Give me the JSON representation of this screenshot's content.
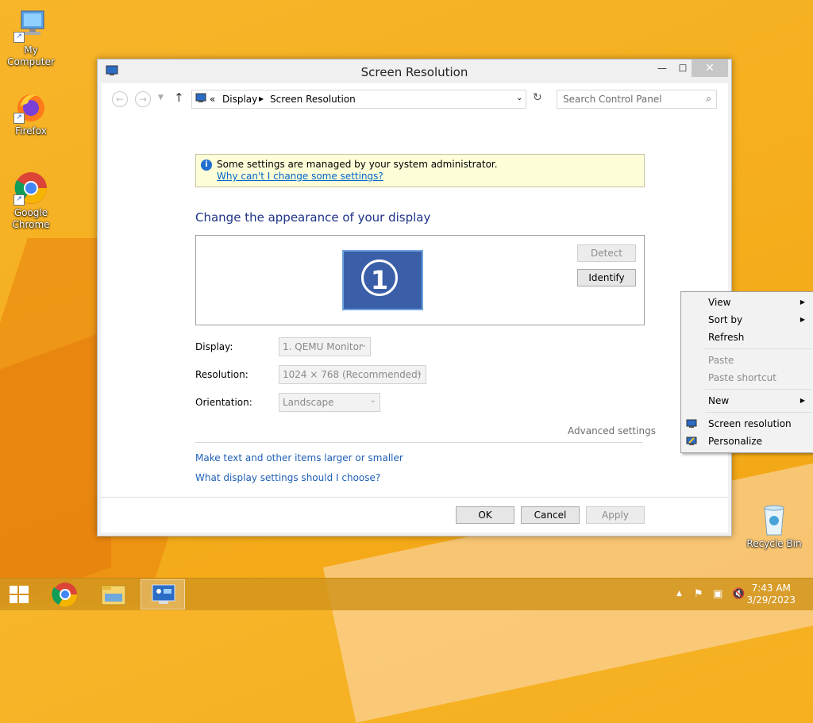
{
  "desktop": {
    "icons": [
      {
        "label": "My Computer"
      },
      {
        "label": "Firefox"
      },
      {
        "label": "Google Chrome"
      },
      {
        "label": "Recycle Bin"
      }
    ]
  },
  "window": {
    "title": "Screen Resolution",
    "controls": {
      "minimize": "—",
      "maximize": "☐",
      "close": "✕"
    },
    "address": {
      "prefix": "«",
      "crumbs": [
        "Display",
        "Screen Resolution"
      ]
    },
    "search": {
      "placeholder": "Search Control Panel"
    },
    "info": {
      "message": "Some settings are managed by your system administrator.",
      "link": "Why can't I change some settings?"
    },
    "heading": "Change the appearance of your display",
    "monitor": {
      "number": "1"
    },
    "buttons": {
      "detect": "Detect",
      "identify": "Identify",
      "ok": "OK",
      "cancel": "Cancel",
      "apply": "Apply"
    },
    "fields": {
      "display": {
        "label": "Display:",
        "value": "1. QEMU Monitor"
      },
      "resolution": {
        "label": "Resolution:",
        "value": "1024 × 768 (Recommended)"
      },
      "orientation": {
        "label": "Orientation:",
        "value": "Landscape"
      }
    },
    "advanced": "Advanced settings",
    "links": [
      "Make text and other items larger or smaller",
      "What display settings should I choose?"
    ]
  },
  "context_menu": {
    "items": [
      {
        "label": "View",
        "submenu": true,
        "disabled": false
      },
      {
        "label": "Sort by",
        "submenu": true,
        "disabled": false
      },
      {
        "label": "Refresh",
        "submenu": false,
        "disabled": false
      },
      {
        "label": "Paste",
        "submenu": false,
        "disabled": true
      },
      {
        "label": "Paste shortcut",
        "submenu": false,
        "disabled": true
      },
      {
        "label": "New",
        "submenu": true,
        "disabled": false
      },
      {
        "label": "Screen resolution",
        "submenu": false,
        "disabled": false
      },
      {
        "label": "Personalize",
        "submenu": false,
        "disabled": false
      }
    ]
  },
  "taskbar": {
    "clock": {
      "time": "7:43 AM",
      "date": "3/29/2023"
    }
  }
}
